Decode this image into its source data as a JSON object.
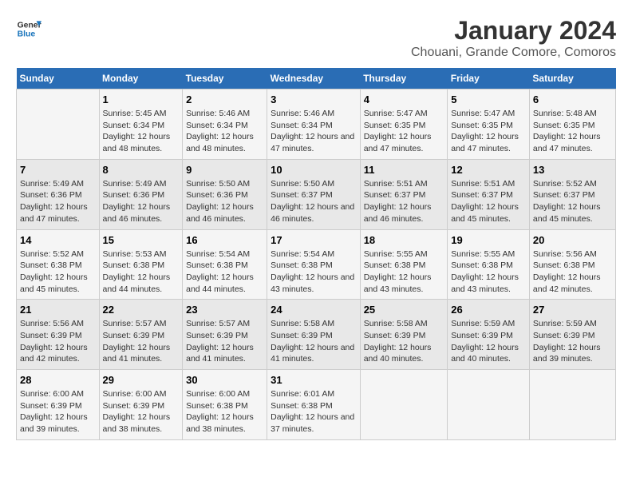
{
  "header": {
    "logo_line1": "General",
    "logo_line2": "Blue",
    "title": "January 2024",
    "subtitle": "Chouani, Grande Comore, Comoros"
  },
  "days_of_week": [
    "Sunday",
    "Monday",
    "Tuesday",
    "Wednesday",
    "Thursday",
    "Friday",
    "Saturday"
  ],
  "weeks": [
    [
      {
        "day": "",
        "info": ""
      },
      {
        "day": "1",
        "info": "Sunrise: 5:45 AM\nSunset: 6:34 PM\nDaylight: 12 hours and 48 minutes."
      },
      {
        "day": "2",
        "info": "Sunrise: 5:46 AM\nSunset: 6:34 PM\nDaylight: 12 hours and 48 minutes."
      },
      {
        "day": "3",
        "info": "Sunrise: 5:46 AM\nSunset: 6:34 PM\nDaylight: 12 hours and 47 minutes."
      },
      {
        "day": "4",
        "info": "Sunrise: 5:47 AM\nSunset: 6:35 PM\nDaylight: 12 hours and 47 minutes."
      },
      {
        "day": "5",
        "info": "Sunrise: 5:47 AM\nSunset: 6:35 PM\nDaylight: 12 hours and 47 minutes."
      },
      {
        "day": "6",
        "info": "Sunrise: 5:48 AM\nSunset: 6:35 PM\nDaylight: 12 hours and 47 minutes."
      }
    ],
    [
      {
        "day": "7",
        "info": "Sunrise: 5:49 AM\nSunset: 6:36 PM\nDaylight: 12 hours and 47 minutes."
      },
      {
        "day": "8",
        "info": "Sunrise: 5:49 AM\nSunset: 6:36 PM\nDaylight: 12 hours and 46 minutes."
      },
      {
        "day": "9",
        "info": "Sunrise: 5:50 AM\nSunset: 6:36 PM\nDaylight: 12 hours and 46 minutes."
      },
      {
        "day": "10",
        "info": "Sunrise: 5:50 AM\nSunset: 6:37 PM\nDaylight: 12 hours and 46 minutes."
      },
      {
        "day": "11",
        "info": "Sunrise: 5:51 AM\nSunset: 6:37 PM\nDaylight: 12 hours and 46 minutes."
      },
      {
        "day": "12",
        "info": "Sunrise: 5:51 AM\nSunset: 6:37 PM\nDaylight: 12 hours and 45 minutes."
      },
      {
        "day": "13",
        "info": "Sunrise: 5:52 AM\nSunset: 6:37 PM\nDaylight: 12 hours and 45 minutes."
      }
    ],
    [
      {
        "day": "14",
        "info": "Sunrise: 5:52 AM\nSunset: 6:38 PM\nDaylight: 12 hours and 45 minutes."
      },
      {
        "day": "15",
        "info": "Sunrise: 5:53 AM\nSunset: 6:38 PM\nDaylight: 12 hours and 44 minutes."
      },
      {
        "day": "16",
        "info": "Sunrise: 5:54 AM\nSunset: 6:38 PM\nDaylight: 12 hours and 44 minutes."
      },
      {
        "day": "17",
        "info": "Sunrise: 5:54 AM\nSunset: 6:38 PM\nDaylight: 12 hours and 43 minutes."
      },
      {
        "day": "18",
        "info": "Sunrise: 5:55 AM\nSunset: 6:38 PM\nDaylight: 12 hours and 43 minutes."
      },
      {
        "day": "19",
        "info": "Sunrise: 5:55 AM\nSunset: 6:38 PM\nDaylight: 12 hours and 43 minutes."
      },
      {
        "day": "20",
        "info": "Sunrise: 5:56 AM\nSunset: 6:38 PM\nDaylight: 12 hours and 42 minutes."
      }
    ],
    [
      {
        "day": "21",
        "info": "Sunrise: 5:56 AM\nSunset: 6:39 PM\nDaylight: 12 hours and 42 minutes."
      },
      {
        "day": "22",
        "info": "Sunrise: 5:57 AM\nSunset: 6:39 PM\nDaylight: 12 hours and 41 minutes."
      },
      {
        "day": "23",
        "info": "Sunrise: 5:57 AM\nSunset: 6:39 PM\nDaylight: 12 hours and 41 minutes."
      },
      {
        "day": "24",
        "info": "Sunrise: 5:58 AM\nSunset: 6:39 PM\nDaylight: 12 hours and 41 minutes."
      },
      {
        "day": "25",
        "info": "Sunrise: 5:58 AM\nSunset: 6:39 PM\nDaylight: 12 hours and 40 minutes."
      },
      {
        "day": "26",
        "info": "Sunrise: 5:59 AM\nSunset: 6:39 PM\nDaylight: 12 hours and 40 minutes."
      },
      {
        "day": "27",
        "info": "Sunrise: 5:59 AM\nSunset: 6:39 PM\nDaylight: 12 hours and 39 minutes."
      }
    ],
    [
      {
        "day": "28",
        "info": "Sunrise: 6:00 AM\nSunset: 6:39 PM\nDaylight: 12 hours and 39 minutes."
      },
      {
        "day": "29",
        "info": "Sunrise: 6:00 AM\nSunset: 6:39 PM\nDaylight: 12 hours and 38 minutes."
      },
      {
        "day": "30",
        "info": "Sunrise: 6:00 AM\nSunset: 6:38 PM\nDaylight: 12 hours and 38 minutes."
      },
      {
        "day": "31",
        "info": "Sunrise: 6:01 AM\nSunset: 6:38 PM\nDaylight: 12 hours and 37 minutes."
      },
      {
        "day": "",
        "info": ""
      },
      {
        "day": "",
        "info": ""
      },
      {
        "day": "",
        "info": ""
      }
    ]
  ]
}
